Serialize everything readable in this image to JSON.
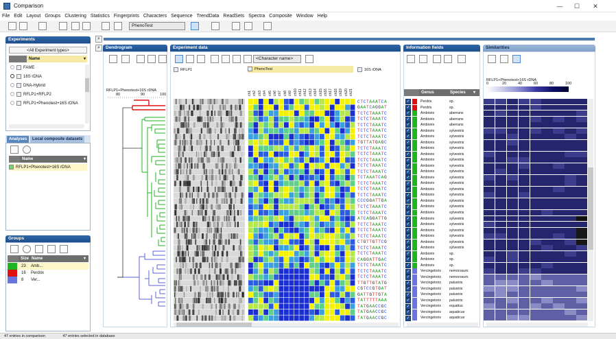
{
  "window": {
    "title": "Comparison",
    "controls": [
      "—",
      "☐",
      "✕"
    ]
  },
  "menu": [
    "File",
    "Edit",
    "Layout",
    "Groups",
    "Clustering",
    "Statistics",
    "Fingerprints",
    "Characters",
    "Sequence",
    "TrendData",
    "ReadSets",
    "Spectra",
    "Composite",
    "Window",
    "Help"
  ],
  "toolbar": {
    "pheno_combo": "PhenoTest"
  },
  "experiments": {
    "title": "Experiments",
    "filter": "<All Experiment types>",
    "column": "Name",
    "items": [
      "FAME",
      "16S rDNA",
      "DNA-Hybrid",
      "RFLP1+RFLP2",
      "RFLP1+Phenotest+16S rDNA"
    ]
  },
  "analyses": {
    "tabs": [
      "Analyses",
      "Local composite datasets"
    ],
    "column": "Name",
    "items": [
      "RFLP1+Phenotest+16S rDNA"
    ]
  },
  "groups": {
    "title": "Groups",
    "columns": [
      "Size",
      "Name"
    ],
    "items": [
      {
        "size": "23",
        "name": "Amb...",
        "color": "#1fb51f"
      },
      {
        "size": "16",
        "name": "Perdrix",
        "color": "#e01010"
      },
      {
        "size": "8",
        "name": "Ver...",
        "color": "#6b73e0"
      }
    ]
  },
  "dendrogram": {
    "title": "Dendrogram",
    "label": "RFLP1+Phenotest+16S rDNA",
    "scale": [
      "80",
      "90",
      "100"
    ]
  },
  "experiment_data": {
    "title": "Experiment data",
    "char_combo": "<Character name>",
    "sections": [
      "RFLP1",
      "PhenoTest",
      "16S rDNA"
    ],
    "char_names": [
      "ch1",
      "ch2",
      "ch3",
      "ch4",
      "ch5",
      "ch6",
      "ch7",
      "ch8",
      "ch9",
      "ch10",
      "ch11",
      "ch12",
      "ch13",
      "ch14",
      "ch15",
      "ch16",
      "ch17",
      "ch18",
      "ch19",
      "ch20",
      "ch21"
    ],
    "sequences": [
      "CTCTAAATCA",
      "GAATCAGGAT",
      "TCTCTAAATC",
      "TCTCTAAATC",
      "TCTCTAAATC",
      "TCTCTAAATC",
      "TCTCTAAATC",
      "TGTTATGAGC",
      "TCTCTAAATC",
      "TCTCTAAATC",
      "TCTCTAAATC",
      "TCTCTAAATC",
      "TCTCTAAATC",
      "TCTAAATCAG",
      "TCTCTAAATC",
      "TCTCTAAATC",
      "TCTCTAAATC",
      "CCCGGATTGA",
      "TCTCTAAATC",
      "TCTCTAAATC",
      "ATCAGGATTG",
      "TCTCTAAATC",
      "TCTCTAAATC",
      "TCTCTAAATC",
      "CTGTTGTTCG",
      "TCTCTAAATC",
      "TCTCTAAATC",
      "CAGGATTGAC",
      "TCTCTAAATC",
      "TCTCTAAATC",
      "TCTCTAAATC",
      "TTGTTGTATG",
      "CGTCCGTGAT",
      "GATTGTTGTA",
      "TATTTTTAAA",
      "TATGAACCGC",
      "TATGAACCGC",
      "TATGAACCGC"
    ]
  },
  "information_fields": {
    "title": "Information fields",
    "columns": [
      "Genus",
      "Species"
    ],
    "rows": [
      [
        "Perdrix",
        "sp."
      ],
      [
        "Perdrix",
        "sp."
      ],
      [
        "Ambiorix",
        "aberrans"
      ],
      [
        "Ambiorix",
        "aberrans"
      ],
      [
        "Ambiorix",
        "aberrans"
      ],
      [
        "Ambiorix",
        "sylvestris"
      ],
      [
        "Ambiorix",
        "sylvestris"
      ],
      [
        "Ambiorix",
        "sylvestris"
      ],
      [
        "Ambiorix",
        "sylvestris"
      ],
      [
        "Ambiorix",
        "sylvestris"
      ],
      [
        "Ambiorix",
        "sylvestris"
      ],
      [
        "Ambiorix",
        "sylvestris"
      ],
      [
        "Ambiorix",
        "sylvestris"
      ],
      [
        "Ambiorix",
        "sylvestris"
      ],
      [
        "Ambiorix",
        "sylvestris"
      ],
      [
        "Ambiorix",
        "sylvestris"
      ],
      [
        "Ambiorix",
        "sylvestris"
      ],
      [
        "Ambiorix",
        "sylvestris"
      ],
      [
        "Ambiorix",
        "sylvestris"
      ],
      [
        "Ambiorix",
        "sylvestris"
      ],
      [
        "Ambiorix",
        "sylvestris"
      ],
      [
        "Ambiorix",
        "sylvestris"
      ],
      [
        "Ambiorix",
        "sylvestris"
      ],
      [
        "Ambiorix",
        "sylvestris"
      ],
      [
        "Ambiorix",
        "sylvestris"
      ],
      [
        "Ambiorix",
        "sylvestris"
      ],
      [
        "Ambiorix",
        "sp."
      ],
      [
        "Ambiorix",
        "sp."
      ],
      [
        "Ambiorix",
        "sp."
      ],
      [
        "Vercingetorix",
        "nemorosum"
      ],
      [
        "Vercingetorix",
        "nemorosum"
      ],
      [
        "Vercingetorix",
        "palustris"
      ],
      [
        "Vercingetorix",
        "palustris"
      ],
      [
        "Vercingetorix",
        "palustris"
      ],
      [
        "Vercingetorix",
        "palustris"
      ],
      [
        "Vercingetorix",
        "equatius"
      ],
      [
        "Vercingetorix",
        "aquaticus"
      ],
      [
        "Vercingetorix",
        "aquaticus"
      ]
    ]
  },
  "similarities": {
    "title": "Similarities",
    "label": "RFLP1+Phenotest+16S rDNA",
    "scale": [
      "0",
      "20",
      "40",
      "60",
      "80",
      "100"
    ]
  },
  "status": [
    "47 entries in comparison",
    "47 entries selected in database"
  ],
  "colors": {
    "accent": "#1d4f8c",
    "green": "#1fb51f",
    "red": "#e01010",
    "blue": "#6b73e0",
    "heat_blue": "#1b2fd0",
    "heat_yellow": "#f3f300",
    "heat_green": "#5fd08a"
  }
}
